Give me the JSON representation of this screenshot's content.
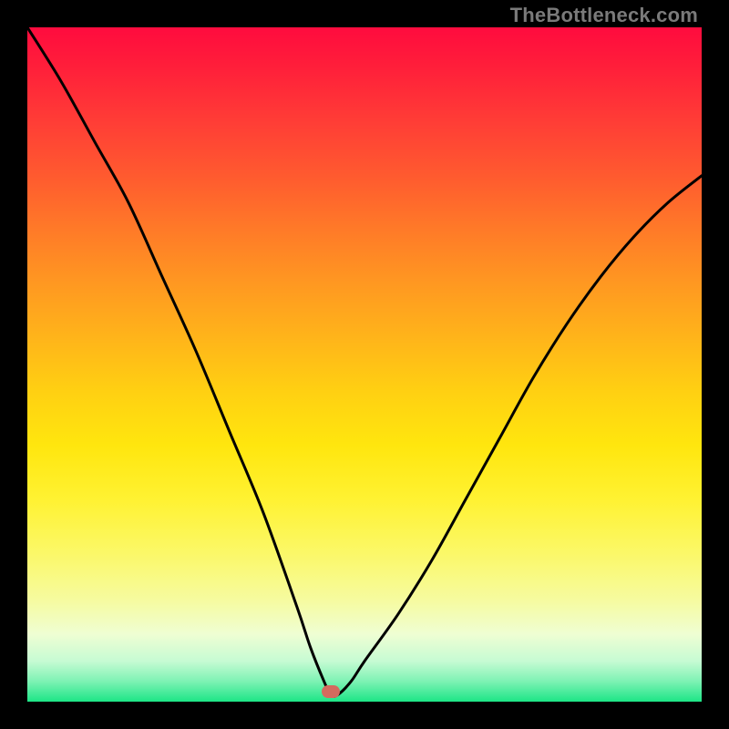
{
  "watermark": "TheBottleneck.com",
  "colors": {
    "frame": "#000000",
    "curve": "#000000",
    "marker": "#d46a5e",
    "gradient_top": "#ff0b3e",
    "gradient_bottom": "#1de586"
  },
  "chart_data": {
    "type": "line",
    "title": "",
    "xlabel": "",
    "ylabel": "",
    "xlim": [
      0,
      100
    ],
    "ylim": [
      0,
      100
    ],
    "annotations": [
      {
        "name": "optimum-marker",
        "x": 45,
        "y": 1.5
      }
    ],
    "series": [
      {
        "name": "bottleneck-curve",
        "x": [
          0,
          5,
          10,
          15,
          20,
          25,
          30,
          35,
          40,
          42,
          44,
          45,
          46,
          48,
          50,
          55,
          60,
          65,
          70,
          75,
          80,
          85,
          90,
          95,
          100
        ],
        "values": [
          100,
          92,
          83,
          74,
          63,
          52,
          40,
          28,
          14,
          8,
          3,
          1,
          1,
          3,
          6,
          13,
          21,
          30,
          39,
          48,
          56,
          63,
          69,
          74,
          78
        ]
      }
    ]
  }
}
